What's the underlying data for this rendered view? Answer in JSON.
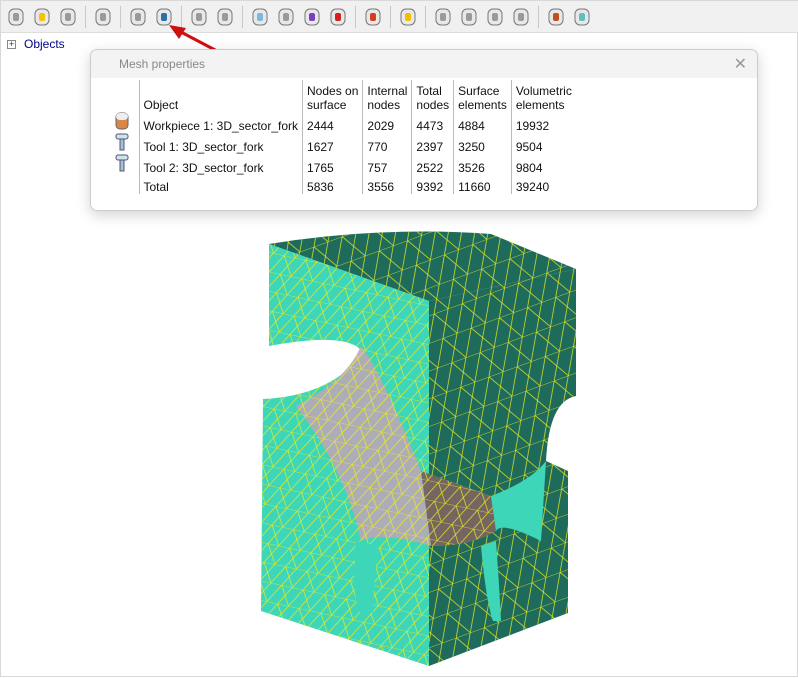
{
  "toolbar": {
    "icons": [
      "object-info-icon",
      "cylinder-icon",
      "3d-view-icon",
      "sphere-icon",
      "mesh-icon",
      "mesh-properties-icon",
      "mesh-wireframe-icon",
      "node-numbers-icon",
      "ruler-icon",
      "distance-icon",
      "grid-icon",
      "bounding-box-icon",
      "graph-icon",
      "add-object-icon",
      "workpiece-icon",
      "tool-icon",
      "cut-icon",
      "rotate-icon",
      "edit-icon",
      "3d-edit-icon"
    ]
  },
  "tree": {
    "expand": "+",
    "label": "Objects"
  },
  "dialog": {
    "title": "Mesh properties",
    "close": "✕",
    "columns": [
      [
        "Object",
        ""
      ],
      [
        "Nodes on",
        "surface"
      ],
      [
        "Internal",
        "nodes"
      ],
      [
        "Total",
        "nodes"
      ],
      [
        "Surface",
        "elements"
      ],
      [
        "Volumetric",
        "elements"
      ]
    ],
    "rows": [
      {
        "icon": "workpiece-icon",
        "cells": [
          "Workpiece 1: 3D_sector_fork",
          "2444",
          "2029",
          "4473",
          "4884",
          "19932"
        ]
      },
      {
        "icon": "tool-icon",
        "cells": [
          "Tool 1: 3D_sector_fork",
          "1627",
          "770",
          "2397",
          "3250",
          "9504"
        ]
      },
      {
        "icon": "tool-icon",
        "cells": [
          "Tool 2: 3D_sector_fork",
          "1765",
          "757",
          "2522",
          "3526",
          "9804"
        ]
      },
      {
        "icon": "",
        "cells": [
          "Total",
          "5836",
          "3556",
          "9392",
          "11660",
          "39240"
        ]
      }
    ]
  },
  "colors": {
    "mesh_light": "#3dd6b8",
    "mesh_dark": "#1e6b5c",
    "mesh_lines": "#f0f020",
    "cut": "#b9a9b8",
    "arrow": "#d01010"
  }
}
